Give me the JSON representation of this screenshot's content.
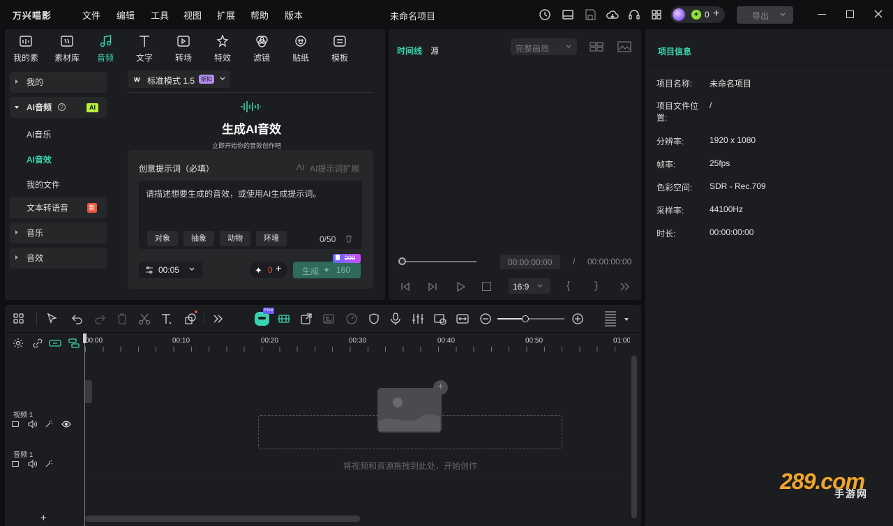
{
  "app": {
    "menu": [
      "文件",
      "编辑",
      "工具",
      "视图",
      "扩展",
      "帮助",
      "版本"
    ],
    "logo_text": "万兴喵影",
    "project_title": "未命名项目",
    "credits": "0",
    "export_label": "导出"
  },
  "categories": [
    {
      "label": "我的素材",
      "icon": "my-media-icon"
    },
    {
      "label": "素材库",
      "icon": "stock-media-icon"
    },
    {
      "label": "音频",
      "icon": "music-note-icon"
    },
    {
      "label": "文字",
      "icon": "text-icon"
    },
    {
      "label": "转场",
      "icon": "transition-icon"
    },
    {
      "label": "特效",
      "icon": "effects-icon"
    },
    {
      "label": "滤镜",
      "icon": "filter-icon"
    },
    {
      "label": "贴纸",
      "icon": "sticker-icon"
    },
    {
      "label": "模板",
      "icon": "template-icon"
    }
  ],
  "sidebar": {
    "mine": "我的",
    "ai_audio": "AI音频",
    "ai_badge": "AI",
    "ai_music": "AI音乐",
    "ai_sfx": "AI音效",
    "my_files": "我的文件",
    "tts": "文本转语音",
    "new_badge": "新",
    "music": "音乐",
    "sound_fx": "音效"
  },
  "generator": {
    "mode": "标准模式 1.5",
    "discount_badge": "折扣",
    "title": "生成AI音效",
    "subtitle": "立即开始你的音效创作吧",
    "prompt_label": "创意提示词（必填）",
    "prompt_expand": "AI提示词扩展",
    "placeholder": "请描述想要生成的音效，或使用AI生成提示词。",
    "chips": [
      "对象",
      "抽象",
      "动物",
      "环境"
    ],
    "counter": "0/50",
    "duration": "00:05",
    "credit_count": "0",
    "generate_label": "生成",
    "generate_cost": "160",
    "original_cost": "200"
  },
  "preview": {
    "tab_timeline": "时间线",
    "tab_source": "源",
    "quality": "完整画质",
    "time_current": "00:00:00:00",
    "time_separator": "/",
    "time_total": "00:00:00:00",
    "aspect": "16:9"
  },
  "info": {
    "title": "项目信息",
    "rows": [
      {
        "label": "项目名称:",
        "value": "未命名项目"
      },
      {
        "label": "项目文件位置:",
        "value": "/"
      },
      {
        "label": "分辨率:",
        "value": "1920 x 1080"
      },
      {
        "label": "帧率:",
        "value": "25fps"
      },
      {
        "label": "色彩空间:",
        "value": "SDR - Rec.709"
      },
      {
        "label": "采样率:",
        "value": "44100Hz"
      },
      {
        "label": "时长:",
        "value": "00:00:00:00"
      }
    ]
  },
  "timeline": {
    "ruler": [
      "00:00",
      "00:10",
      "00:20",
      "00:30",
      "00:40",
      "00:50",
      "01:00"
    ],
    "free_badge": "Free",
    "video_track": "视频 1",
    "audio_track": "音频 1",
    "drop_hint": "将视频和资源拖拽到此处，开始创作"
  },
  "watermark": {
    "brand": "289.com",
    "sub": "手游网"
  },
  "colors": {
    "accent": "#38d4b0",
    "panel": "#1c1d20",
    "bg": "#0f1012",
    "badge_new": "#e8543a",
    "badge_discount": "#b48cf0"
  }
}
